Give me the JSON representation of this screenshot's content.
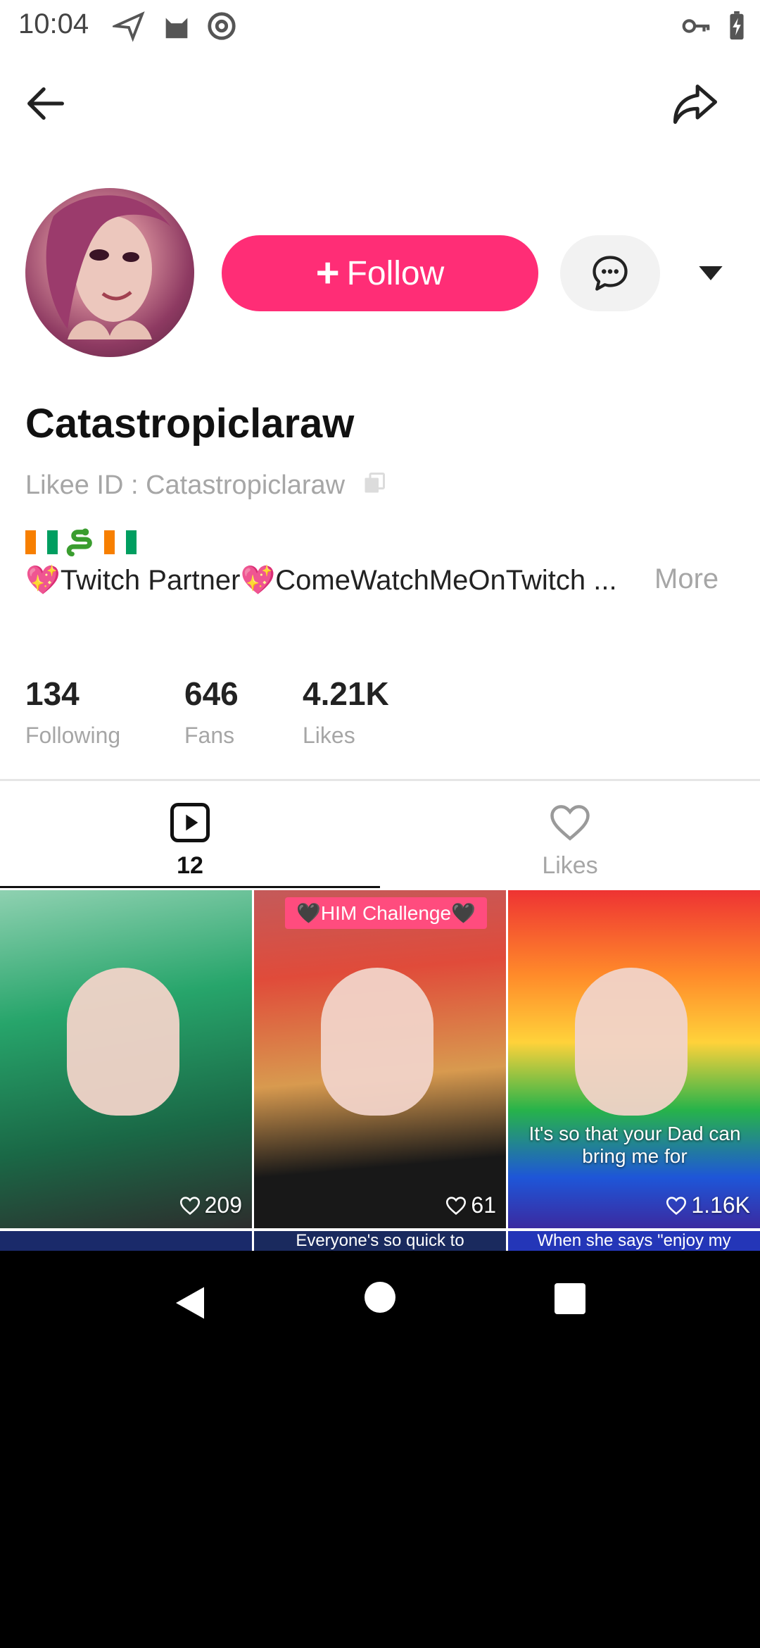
{
  "status_bar": {
    "time": "10:04"
  },
  "profile": {
    "username": "Catastropiclaraw",
    "likee_id": "Likee ID : Catastropiclaraw",
    "follow_label": "Follow",
    "bio": "Twitch Partner",
    "bio_rest": "ComeWatchMeOnTwitch ...",
    "more_label": "More"
  },
  "stats": [
    {
      "value": "134",
      "label": "Following"
    },
    {
      "value": "646",
      "label": "Fans"
    },
    {
      "value": "4.21K",
      "label": "Likes"
    }
  ],
  "tabs": [
    {
      "label": "12",
      "icon": "video-icon",
      "active": true
    },
    {
      "label": "Likes",
      "icon": "heart-icon",
      "active": false
    }
  ],
  "videos": [
    {
      "likes": "209",
      "badge": "",
      "caption": ""
    },
    {
      "likes": "61",
      "badge": "🖤HIM Challenge🖤",
      "caption": ""
    },
    {
      "likes": "1.16K",
      "badge": "",
      "caption": "It's so that your Dad can bring me for"
    }
  ],
  "videos_row2": [
    {
      "caption": ""
    },
    {
      "caption": "Everyone's so quick to"
    },
    {
      "caption": "When she says \"enjoy my leftovers\" but her leftovers"
    }
  ],
  "colors": {
    "accent": "#ff2d76",
    "muted_text": "#a6a6a6"
  }
}
